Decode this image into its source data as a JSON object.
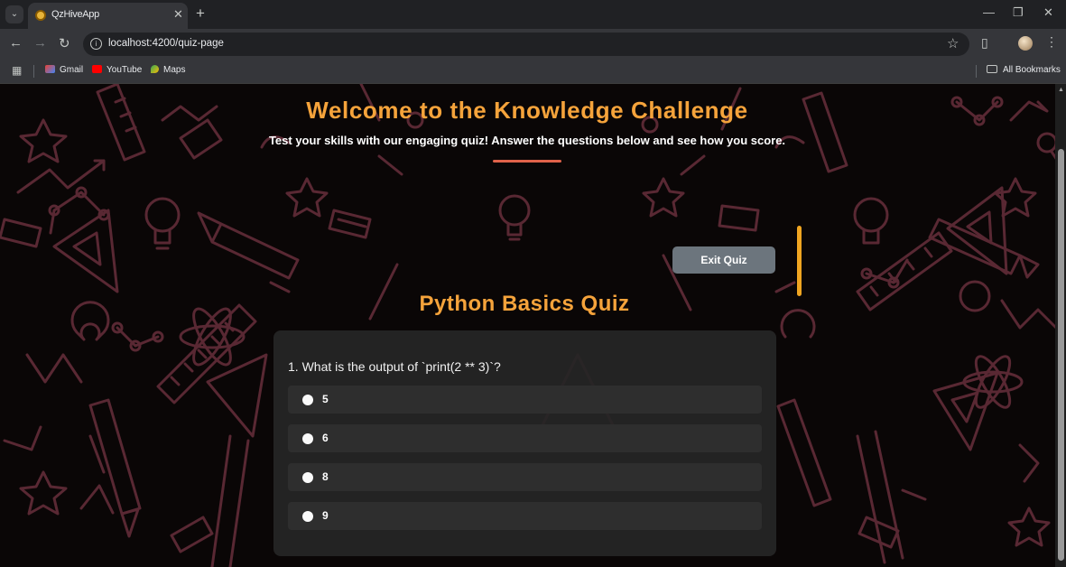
{
  "browser": {
    "tab_title": "QzHiveApp",
    "url": "localhost:4200/quiz-page",
    "bookmarks": [
      "Gmail",
      "YouTube",
      "Maps"
    ],
    "all_bookmarks": "All Bookmarks"
  },
  "header": {
    "title": "Welcome to the Knowledge Challenge",
    "subtitle": "Test your skills with our engaging quiz! Answer the questions below and see how you score."
  },
  "actions": {
    "exit_label": "Exit Quiz"
  },
  "quiz": {
    "title": "Python Basics Quiz",
    "question": "1. What is the output of `print(2 ** 3)`?",
    "options": [
      "5",
      "6",
      "8",
      "9"
    ]
  },
  "colors": {
    "accent": "#f5a33b",
    "underline": "#e0624a",
    "exit_button": "#6c757d",
    "background": "#0a0606",
    "doodles": "#5e2a36"
  }
}
